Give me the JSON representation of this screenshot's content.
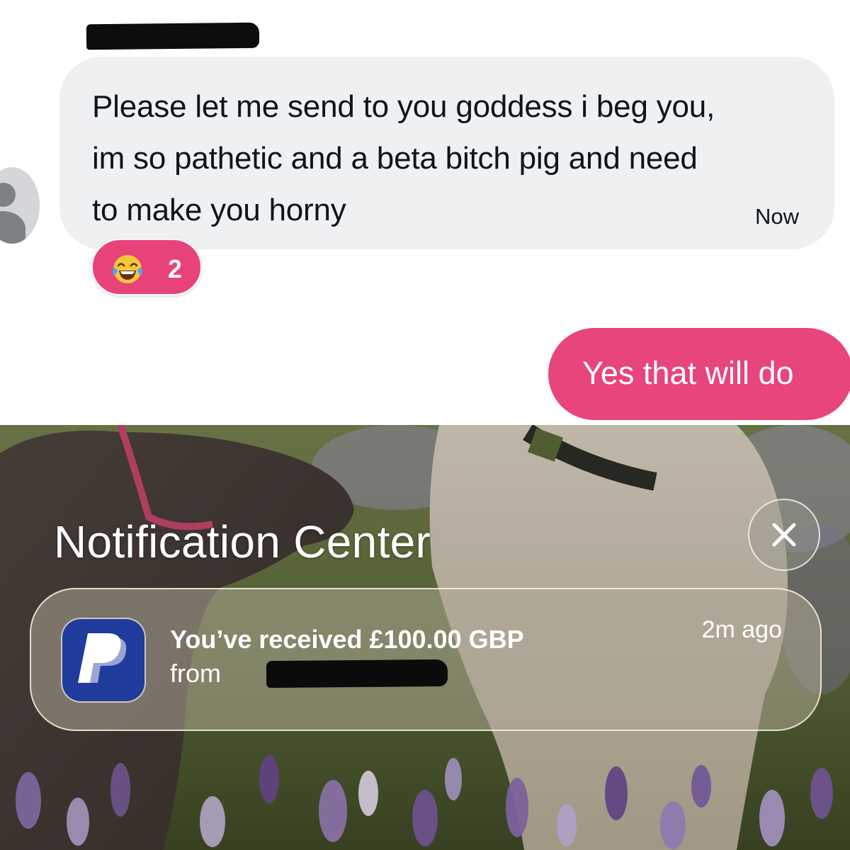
{
  "conversation": {
    "incoming": {
      "text": "Please let me send to you goddess i beg you,\nim so pathetic and a beta bitch pig and need\nto make you horny",
      "timestamp": "Now",
      "reaction": {
        "emoji": "laughing-with-tears",
        "count": "2",
        "color": "#e8427a"
      }
    },
    "outgoing": {
      "text": "Yes that will do",
      "color": "#e8457a"
    },
    "sender_redacted": true
  },
  "notification_center": {
    "title": "Notification Center",
    "close_icon": "close-icon",
    "notification": {
      "app_icon": "paypal-icon",
      "title": "You’ve received £100.00 GBP",
      "from_label": "from",
      "from_redacted": true,
      "time": "2m ago"
    }
  },
  "colors": {
    "bubble_incoming": "#eff0f2",
    "bubble_outgoing": "#e8457a",
    "paypal_blue": "#1f3b9b"
  }
}
